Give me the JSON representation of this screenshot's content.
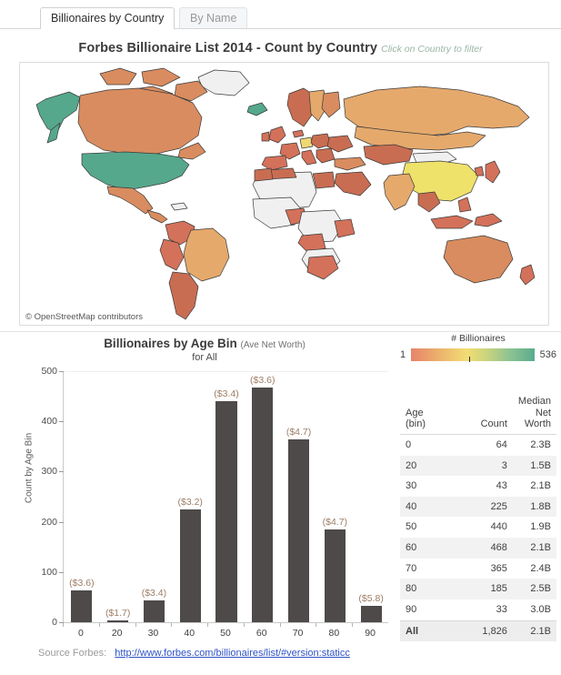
{
  "tabs": [
    {
      "label": "Billionaires by Country",
      "active": true
    },
    {
      "label": "By Name",
      "active": false
    }
  ],
  "map": {
    "title": "Forbes Billionaire List 2014 - Count by Country",
    "hint": "Click on Country to filter",
    "attribution": "© OpenStreetMap contributors"
  },
  "legend": {
    "title": "# Billionaires",
    "min": "1",
    "max": "536",
    "colors": {
      "low": "#e8836a",
      "mid": "#f2dd73",
      "high": "#5aab8f"
    }
  },
  "source": {
    "label": "Source Forbes:",
    "url": "http://www.forbes.com/billionaires/list/#version:staticc"
  },
  "chart_data": {
    "type": "bar",
    "title": "Billionaires by Age Bin",
    "title_suffix": "(Ave Net Worth)",
    "subtitle": "for All",
    "xlabel": "",
    "ylabel": "Count by Age Bin",
    "ylim": [
      0,
      500
    ],
    "yticks": [
      0,
      100,
      200,
      300,
      400,
      500
    ],
    "grid": false,
    "categories": [
      "0",
      "20",
      "30",
      "40",
      "50",
      "60",
      "70",
      "80",
      "90"
    ],
    "values": [
      64,
      3,
      43,
      225,
      440,
      468,
      365,
      185,
      33
    ],
    "point_labels": [
      "($3.6)",
      "($1.7)",
      "($3.4)",
      "($3.2)",
      "($3.4)",
      "($3.6)",
      "($4.7)",
      "($4.7)",
      "($5.8)"
    ],
    "bar_color": "#4d4a49",
    "label_color": "#9d7d66"
  },
  "table": {
    "headers": {
      "age": "Age\n(bin)",
      "age_line1": "Age",
      "age_line2": "(bin)",
      "count": "Count",
      "median_line1": "Median",
      "median_line2": "Net Worth"
    },
    "rows": [
      {
        "age": "0",
        "count": "64",
        "median": "2.3B"
      },
      {
        "age": "20",
        "count": "3",
        "median": "1.5B"
      },
      {
        "age": "30",
        "count": "43",
        "median": "2.1B"
      },
      {
        "age": "40",
        "count": "225",
        "median": "1.8B"
      },
      {
        "age": "50",
        "count": "440",
        "median": "1.9B"
      },
      {
        "age": "60",
        "count": "468",
        "median": "2.1B"
      },
      {
        "age": "70",
        "count": "365",
        "median": "2.4B"
      },
      {
        "age": "80",
        "count": "185",
        "median": "2.5B"
      },
      {
        "age": "90",
        "count": "33",
        "median": "3.0B"
      }
    ],
    "total": {
      "age": "All",
      "count": "1,826",
      "median": "2.1B"
    }
  }
}
